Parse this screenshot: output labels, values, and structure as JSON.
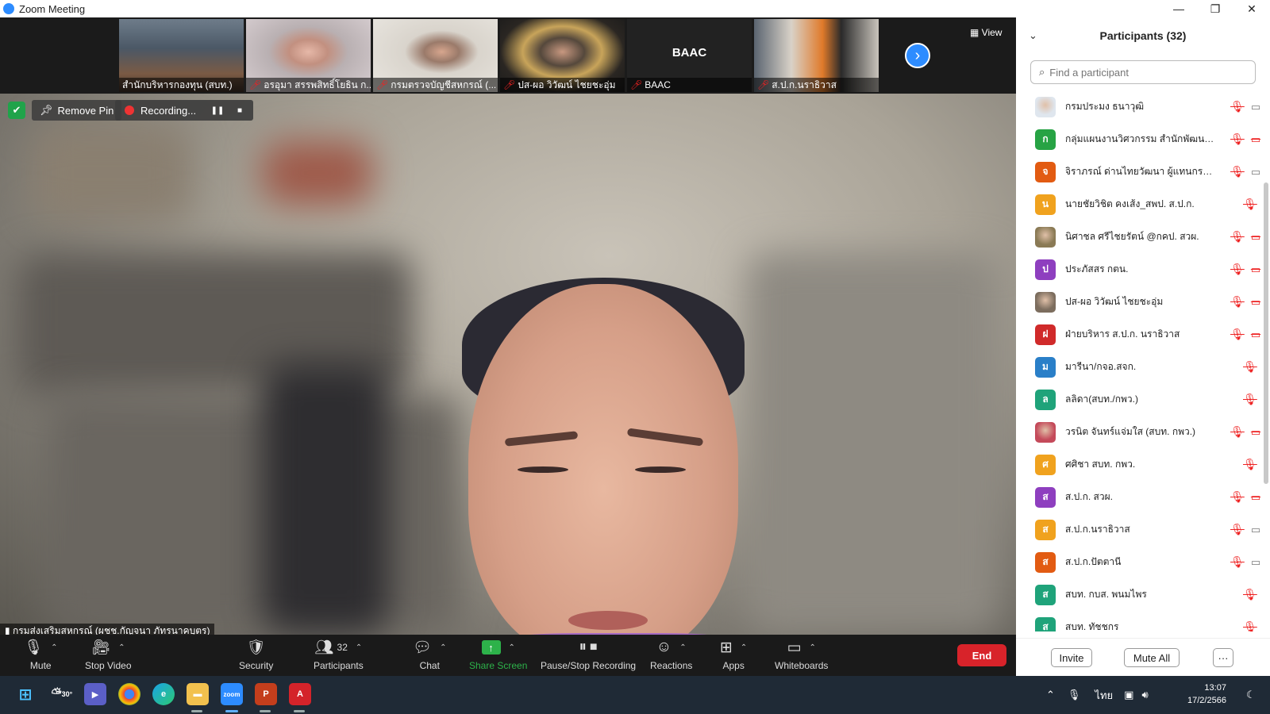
{
  "window": {
    "title": "Zoom Meeting",
    "controls": [
      "—",
      "❐",
      "✕"
    ]
  },
  "thumbnails": [
    {
      "name": "สำนักบริหารกองทุน (สบท.)",
      "muted": false
    },
    {
      "name": "อรอุมา สรรพสิทธิ์โยธิน ก...",
      "muted": true
    },
    {
      "name": "กรมตรวจบัญชีสหกรณ์ (...",
      "muted": true
    },
    {
      "name": "ปส-ผอ วิวัฒน์ ไชยชะอุ่ม",
      "muted": true
    },
    {
      "name": "BAAC",
      "muted": true,
      "big_text": "BAAC"
    },
    {
      "name": "ส.ป.ก.นราธิวาส",
      "muted": true
    }
  ],
  "view_label": "View",
  "overlay": {
    "remove_pin": "Remove Pin",
    "recording": "Recording...",
    "speaker_name": "กรมส่งเสริมสหกรณ์ (ผชช.กัญจนา ภัทรนาคบุตร)"
  },
  "toolbar": {
    "mute": "Mute",
    "stop_video": "Stop Video",
    "security": "Security",
    "participants": "Participants",
    "participants_count": "32",
    "chat": "Chat",
    "share_screen": "Share Screen",
    "pause_stop_recording": "Pause/Stop Recording",
    "reactions": "Reactions",
    "apps": "Apps",
    "whiteboards": "Whiteboards",
    "end": "End"
  },
  "panel": {
    "title": "Participants (32)",
    "search_placeholder": "Find a participant",
    "invite": "Invite",
    "mute_all": "Mute All",
    "more": "···"
  },
  "participants": [
    {
      "initial": "",
      "name": "กรมประมง ธนาวุฒิ",
      "color": "#dfe6ee",
      "photo": true,
      "mic_off": true,
      "cam": "on"
    },
    {
      "initial": "ก",
      "name": "กลุ่มแผนงานวิศวกรรม สำนักพัฒนาพื้...",
      "color": "#27a344",
      "mic_off": true,
      "cam": "off"
    },
    {
      "initial": "จ",
      "name": "จิราภรณ์ ด่านไทยวัฒนา ผู้แทนกรมบั...",
      "color": "#e25b12",
      "mic_off": true,
      "cam": "on"
    },
    {
      "initial": "น",
      "name": "นายชัยวิชิต คงเส้ง_สพป. ส.ป.ก.",
      "color": "#f0a21e",
      "mic_off": false,
      "cam": "none",
      "single_mic": true
    },
    {
      "initial": "",
      "name": "นิศาชล ศรีไชยรัตน์ @กคป. สวผ.",
      "color": "#8a7a55",
      "photo": true,
      "mic_off": true,
      "cam": "off"
    },
    {
      "initial": "ป",
      "name": "ประภัสสร กตน.",
      "color": "#8e3fbf",
      "mic_off": true,
      "cam": "off"
    },
    {
      "initial": "",
      "name": "ปส-ผอ วิวัฒน์ ไชยชะอุ่ม",
      "color": "#7c6d5e",
      "photo": true,
      "mic_off": true,
      "cam": "off"
    },
    {
      "initial": "ฝ",
      "name": "ฝ่ายบริหาร ส.ป.ก. นราธิวาส",
      "color": "#d02a2a",
      "mic_off": true,
      "cam": "off"
    },
    {
      "initial": "ม",
      "name": "มารีนา/กจอ.สจก.",
      "color": "#2a7fc8",
      "mic_off": false,
      "cam": "none",
      "single_mic": true
    },
    {
      "initial": "ล",
      "name": "ลลิดา(สบท./กพว.)",
      "color": "#1fa37a",
      "mic_off": false,
      "cam": "none",
      "single_mic": true
    },
    {
      "initial": "",
      "name": "วรนิต จันทร์แจ่มใส (สบท. กพว.)",
      "color": "#c44a5a",
      "photo": true,
      "mic_off": true,
      "cam": "off"
    },
    {
      "initial": "ศ",
      "name": "ศศิชา สบท. กพว.",
      "color": "#f0a21e",
      "mic_off": false,
      "cam": "none",
      "single_mic": true
    },
    {
      "initial": "ส",
      "name": "ส.ป.ก. สวผ.",
      "color": "#8e3fbf",
      "mic_off": true,
      "cam": "off"
    },
    {
      "initial": "ส",
      "name": "ส.ป.ก.นราธิวาส",
      "color": "#f0a21e",
      "mic_off": true,
      "cam": "on"
    },
    {
      "initial": "ส",
      "name": "ส.ป.ก.ปัตตานี",
      "color": "#e25b12",
      "mic_off": true,
      "cam": "on"
    },
    {
      "initial": "ส",
      "name": "สบท. กบส. พนมไพร",
      "color": "#1fa37a",
      "mic_off": false,
      "cam": "none",
      "single_mic": true
    },
    {
      "initial": "ส",
      "name": "สบท. ทัชชกร",
      "color": "#1fa37a",
      "mic_off": false,
      "cam": "none",
      "single_mic": true
    }
  ],
  "taskbar": {
    "weather": "30°",
    "lang": "ไทย",
    "time": "13:07",
    "date": "17/2/2566"
  }
}
